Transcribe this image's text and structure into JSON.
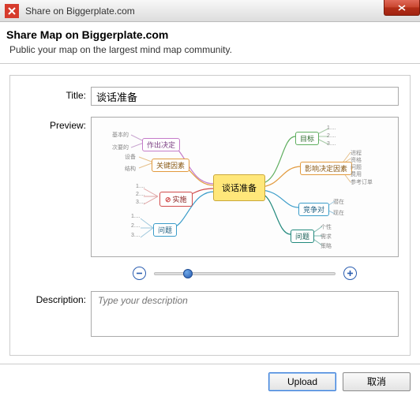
{
  "window": {
    "title": "Share on Biggerplate.com"
  },
  "header": {
    "heading": "Share Map on Biggerplate.com",
    "subheading": "Public your map on the largest mind map community."
  },
  "form": {
    "title_label": "Title:",
    "title_value": "谈话准备",
    "preview_label": "Preview:",
    "description_label": "Description:",
    "description_placeholder": "Type your description"
  },
  "mindmap": {
    "center": "谈话准备",
    "left": {
      "n1": "作出决定",
      "n1a": "基本的",
      "n1b": "次要的",
      "n2": "关键因素",
      "n2a": "设备",
      "n2b": "结构",
      "n3": "实施",
      "n3_nums": [
        "1....",
        "2....",
        "3...."
      ],
      "n4": "问题",
      "n4_nums": [
        "1....",
        "2....",
        "3...."
      ]
    },
    "right": {
      "n1": "目标",
      "n1_nums": [
        "1....",
        "2....",
        "3...."
      ],
      "n2": "影响决定因素",
      "n2a": "进程",
      "n2b": "资格",
      "n2c": "问题",
      "n2d": "费用",
      "n2e": "参考订单",
      "n3": "竞争对",
      "n3a": "潜在",
      "n3b": "现在",
      "n4": "问题",
      "n4a": "个性",
      "n4b": "需求",
      "n4c": "策略"
    }
  },
  "buttons": {
    "upload": "Upload",
    "cancel": "取消"
  }
}
